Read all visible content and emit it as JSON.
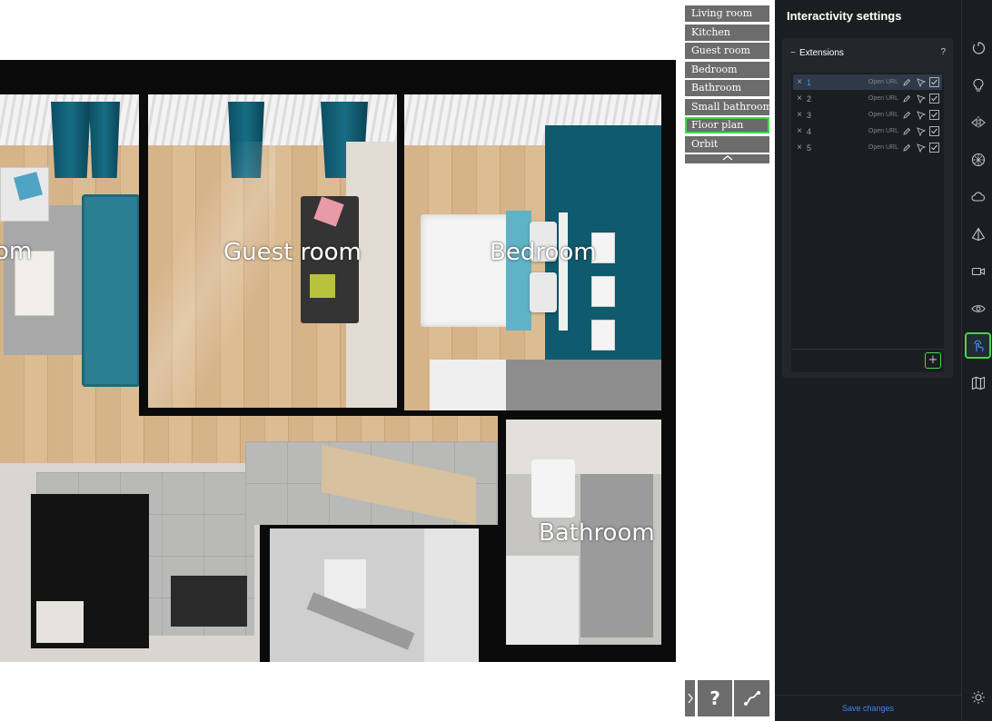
{
  "viewer": {
    "room_labels": [
      "om",
      "Guest room",
      "Bedroom",
      "Bathroom"
    ],
    "views": [
      {
        "label": "Living room",
        "active": false
      },
      {
        "label": "Kitchen",
        "active": false
      },
      {
        "label": "Guest room",
        "active": false
      },
      {
        "label": "Bedroom",
        "active": false
      },
      {
        "label": "Bathroom",
        "active": false
      },
      {
        "label": "Small bathroom",
        "active": false
      },
      {
        "label": "Floor plan",
        "active": true
      },
      {
        "label": "Orbit",
        "active": false
      }
    ],
    "collapse_icon": "chevron-up-icon",
    "controls": {
      "expand_icon": "chevron-right-icon",
      "help_label": "?",
      "path_icon": "path-icon"
    }
  },
  "panel": {
    "title": "Interactivity settings",
    "section_title": "Extensions",
    "section_help": "?",
    "collapse_symbol": "−",
    "extensions": [
      {
        "id": "1",
        "action": "Open URL",
        "selected": true
      },
      {
        "id": "2",
        "action": "Open URL",
        "selected": false
      },
      {
        "id": "3",
        "action": "Open URL",
        "selected": false
      },
      {
        "id": "4",
        "action": "Open URL",
        "selected": false
      },
      {
        "id": "5",
        "action": "Open URL",
        "selected": false
      }
    ],
    "add_symbol": "+",
    "save_label": "Save changes"
  },
  "rail": {
    "icons": [
      "power-icon",
      "lightbulb-icon",
      "mirror-icon",
      "texture-icon",
      "cloud-icon",
      "pyramid-icon",
      "camera-icon",
      "eye-icon",
      "touch-icon",
      "map-icon"
    ],
    "active": "touch-icon",
    "bottom_icon": "sun-icon"
  },
  "colors": {
    "accent_green": "#44d64e",
    "link_blue": "#3d86ef",
    "panel_bg": "#1b1e21",
    "teal": "#0f5f73"
  }
}
